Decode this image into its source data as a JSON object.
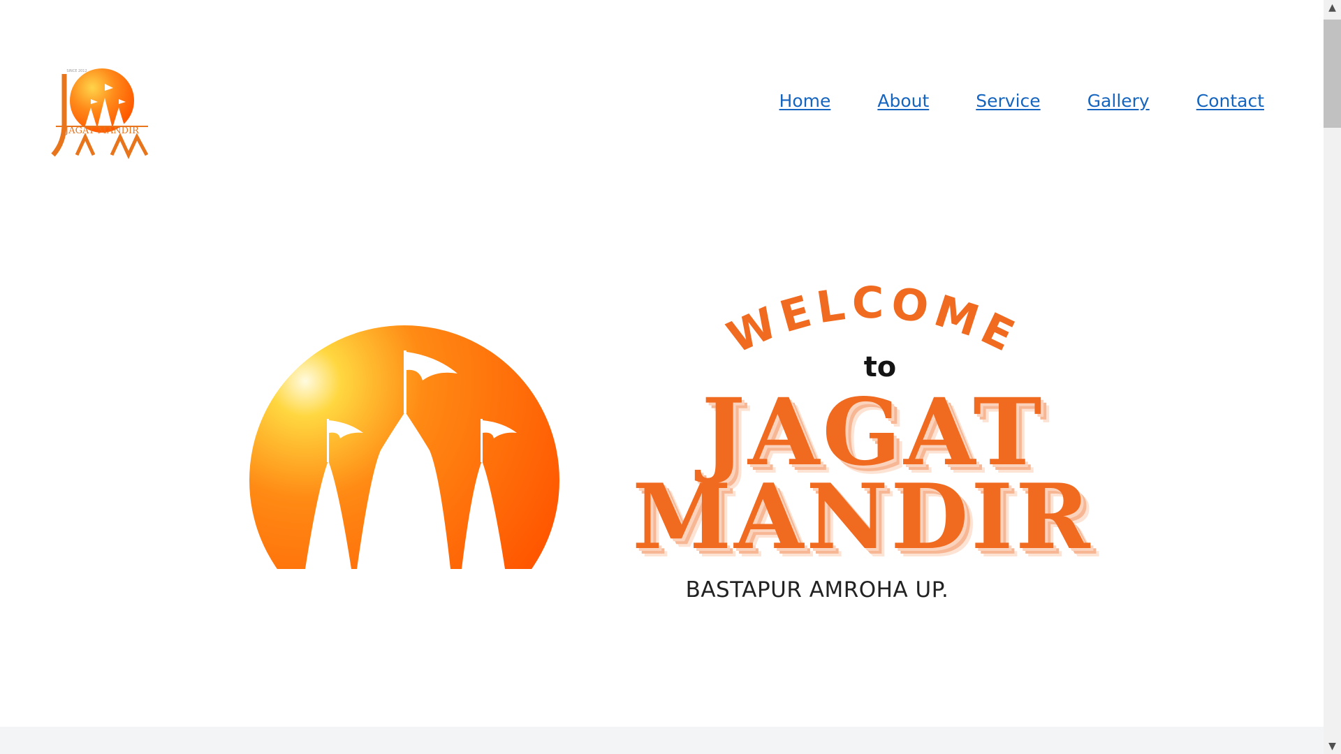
{
  "logo": {
    "monogram": "JM",
    "text": "JAGAT MANDIR",
    "since": "SINCE 2012",
    "color_primary": "#ff6a00",
    "color_secondary": "#e87a1e"
  },
  "nav": {
    "items": [
      {
        "label": "Home"
      },
      {
        "label": "About"
      },
      {
        "label": "Service"
      },
      {
        "label": "Gallery"
      },
      {
        "label": "Contact"
      }
    ],
    "link_color": "#1565c0"
  },
  "hero": {
    "welcome": "WELCOME",
    "to": "to",
    "title_line1": "JAGAT",
    "title_line2": "MANDIR",
    "location": "BASTAPUR AMROHA UP.",
    "accent_color": "#f06a20"
  },
  "scrollbar": {
    "up_icon": "chevron-up-icon",
    "down_icon": "chevron-down-icon"
  }
}
